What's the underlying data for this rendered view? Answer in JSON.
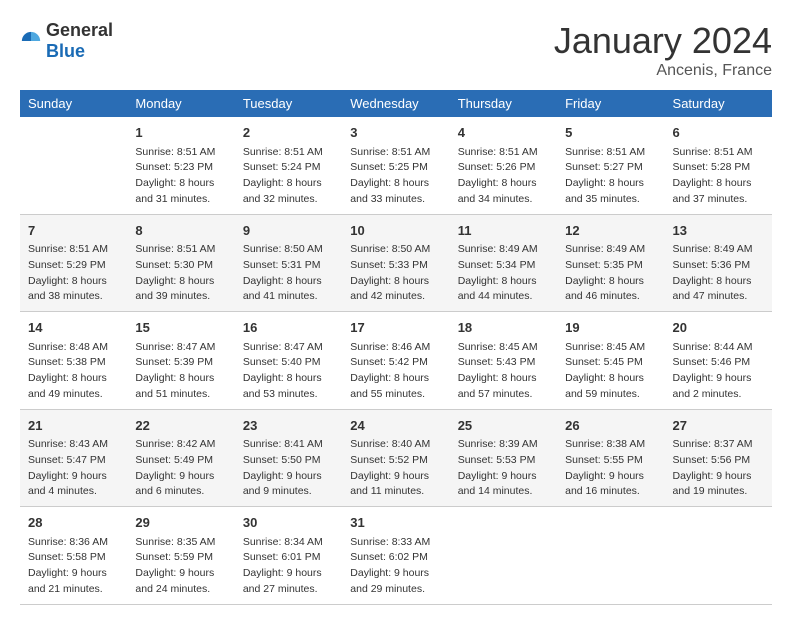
{
  "logo": {
    "general": "General",
    "blue": "Blue"
  },
  "title": "January 2024",
  "location": "Ancenis, France",
  "days_of_week": [
    "Sunday",
    "Monday",
    "Tuesday",
    "Wednesday",
    "Thursday",
    "Friday",
    "Saturday"
  ],
  "weeks": [
    [
      {
        "day": "",
        "info": ""
      },
      {
        "day": "1",
        "info": "Sunrise: 8:51 AM\nSunset: 5:23 PM\nDaylight: 8 hours\nand 31 minutes."
      },
      {
        "day": "2",
        "info": "Sunrise: 8:51 AM\nSunset: 5:24 PM\nDaylight: 8 hours\nand 32 minutes."
      },
      {
        "day": "3",
        "info": "Sunrise: 8:51 AM\nSunset: 5:25 PM\nDaylight: 8 hours\nand 33 minutes."
      },
      {
        "day": "4",
        "info": "Sunrise: 8:51 AM\nSunset: 5:26 PM\nDaylight: 8 hours\nand 34 minutes."
      },
      {
        "day": "5",
        "info": "Sunrise: 8:51 AM\nSunset: 5:27 PM\nDaylight: 8 hours\nand 35 minutes."
      },
      {
        "day": "6",
        "info": "Sunrise: 8:51 AM\nSunset: 5:28 PM\nDaylight: 8 hours\nand 37 minutes."
      }
    ],
    [
      {
        "day": "7",
        "info": "Sunrise: 8:51 AM\nSunset: 5:29 PM\nDaylight: 8 hours\nand 38 minutes."
      },
      {
        "day": "8",
        "info": "Sunrise: 8:51 AM\nSunset: 5:30 PM\nDaylight: 8 hours\nand 39 minutes."
      },
      {
        "day": "9",
        "info": "Sunrise: 8:50 AM\nSunset: 5:31 PM\nDaylight: 8 hours\nand 41 minutes."
      },
      {
        "day": "10",
        "info": "Sunrise: 8:50 AM\nSunset: 5:33 PM\nDaylight: 8 hours\nand 42 minutes."
      },
      {
        "day": "11",
        "info": "Sunrise: 8:49 AM\nSunset: 5:34 PM\nDaylight: 8 hours\nand 44 minutes."
      },
      {
        "day": "12",
        "info": "Sunrise: 8:49 AM\nSunset: 5:35 PM\nDaylight: 8 hours\nand 46 minutes."
      },
      {
        "day": "13",
        "info": "Sunrise: 8:49 AM\nSunset: 5:36 PM\nDaylight: 8 hours\nand 47 minutes."
      }
    ],
    [
      {
        "day": "14",
        "info": "Sunrise: 8:48 AM\nSunset: 5:38 PM\nDaylight: 8 hours\nand 49 minutes."
      },
      {
        "day": "15",
        "info": "Sunrise: 8:47 AM\nSunset: 5:39 PM\nDaylight: 8 hours\nand 51 minutes."
      },
      {
        "day": "16",
        "info": "Sunrise: 8:47 AM\nSunset: 5:40 PM\nDaylight: 8 hours\nand 53 minutes."
      },
      {
        "day": "17",
        "info": "Sunrise: 8:46 AM\nSunset: 5:42 PM\nDaylight: 8 hours\nand 55 minutes."
      },
      {
        "day": "18",
        "info": "Sunrise: 8:45 AM\nSunset: 5:43 PM\nDaylight: 8 hours\nand 57 minutes."
      },
      {
        "day": "19",
        "info": "Sunrise: 8:45 AM\nSunset: 5:45 PM\nDaylight: 8 hours\nand 59 minutes."
      },
      {
        "day": "20",
        "info": "Sunrise: 8:44 AM\nSunset: 5:46 PM\nDaylight: 9 hours\nand 2 minutes."
      }
    ],
    [
      {
        "day": "21",
        "info": "Sunrise: 8:43 AM\nSunset: 5:47 PM\nDaylight: 9 hours\nand 4 minutes."
      },
      {
        "day": "22",
        "info": "Sunrise: 8:42 AM\nSunset: 5:49 PM\nDaylight: 9 hours\nand 6 minutes."
      },
      {
        "day": "23",
        "info": "Sunrise: 8:41 AM\nSunset: 5:50 PM\nDaylight: 9 hours\nand 9 minutes."
      },
      {
        "day": "24",
        "info": "Sunrise: 8:40 AM\nSunset: 5:52 PM\nDaylight: 9 hours\nand 11 minutes."
      },
      {
        "day": "25",
        "info": "Sunrise: 8:39 AM\nSunset: 5:53 PM\nDaylight: 9 hours\nand 14 minutes."
      },
      {
        "day": "26",
        "info": "Sunrise: 8:38 AM\nSunset: 5:55 PM\nDaylight: 9 hours\nand 16 minutes."
      },
      {
        "day": "27",
        "info": "Sunrise: 8:37 AM\nSunset: 5:56 PM\nDaylight: 9 hours\nand 19 minutes."
      }
    ],
    [
      {
        "day": "28",
        "info": "Sunrise: 8:36 AM\nSunset: 5:58 PM\nDaylight: 9 hours\nand 21 minutes."
      },
      {
        "day": "29",
        "info": "Sunrise: 8:35 AM\nSunset: 5:59 PM\nDaylight: 9 hours\nand 24 minutes."
      },
      {
        "day": "30",
        "info": "Sunrise: 8:34 AM\nSunset: 6:01 PM\nDaylight: 9 hours\nand 27 minutes."
      },
      {
        "day": "31",
        "info": "Sunrise: 8:33 AM\nSunset: 6:02 PM\nDaylight: 9 hours\nand 29 minutes."
      },
      {
        "day": "",
        "info": ""
      },
      {
        "day": "",
        "info": ""
      },
      {
        "day": "",
        "info": ""
      }
    ]
  ]
}
